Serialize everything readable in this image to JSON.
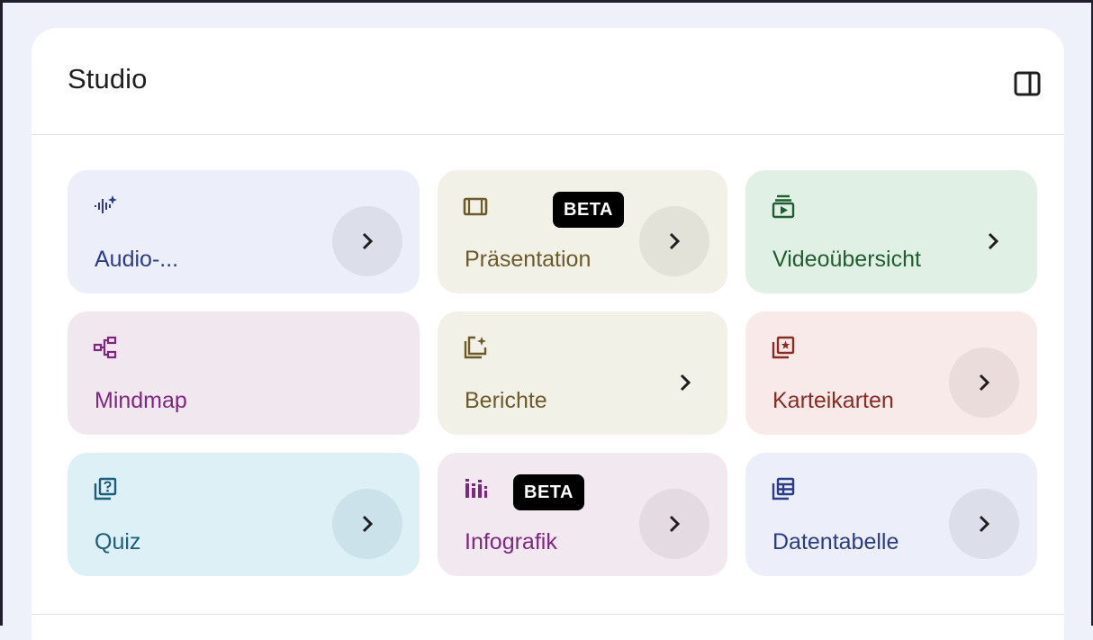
{
  "panel": {
    "title": "Studio",
    "toggle_icon": "dock-to-right-icon"
  },
  "colors": {
    "audio_bg": "#eceef9",
    "audio_text": "#2a3c87",
    "praesentation_bg": "#f2f1e8",
    "praesentation_text": "#6d5a2b",
    "video_bg": "#e1f0e4",
    "video_text": "#1f5f2f",
    "mindmap_bg": "#f1e8ef",
    "mindmap_text": "#7f2680",
    "berichte_bg": "#f2f1e8",
    "berichte_text": "#6d5a2b",
    "karteikarten_bg": "#f8eae8",
    "karteikarten_text": "#8b2b23",
    "quiz_bg": "#ddf0f6",
    "quiz_text": "#1a5d7d",
    "infografik_bg": "#f2e8f0",
    "infografik_text": "#7f2680",
    "datentabelle_bg": "#eceef9",
    "datentabelle_text": "#2a3c87"
  },
  "cards": [
    {
      "label": "Audio-...",
      "icon": "audio-sparkle-icon",
      "arrow": "chevron-right-icon"
    },
    {
      "label": "Präsentation",
      "icon": "slides-icon",
      "badge": "BETA",
      "arrow": "chevron-right-icon"
    },
    {
      "label": "Videoübersicht",
      "icon": "video-collection-icon",
      "arrow": "chevron-right-icon"
    },
    {
      "label": "Mindmap",
      "icon": "mindmap-icon"
    },
    {
      "label": "Berichte",
      "icon": "reports-sparkle-icon",
      "arrow": "chevron-right-icon"
    },
    {
      "label": "Karteikarten",
      "icon": "flashcards-icon",
      "arrow": "chevron-right-icon"
    },
    {
      "label": "Quiz",
      "icon": "quiz-icon",
      "arrow": "chevron-right-icon"
    },
    {
      "label": "Infografik",
      "icon": "infographic-icon",
      "badge": "BETA",
      "arrow": "chevron-right-icon"
    },
    {
      "label": "Datentabelle",
      "icon": "data-table-icon",
      "arrow": "chevron-right-icon"
    }
  ]
}
